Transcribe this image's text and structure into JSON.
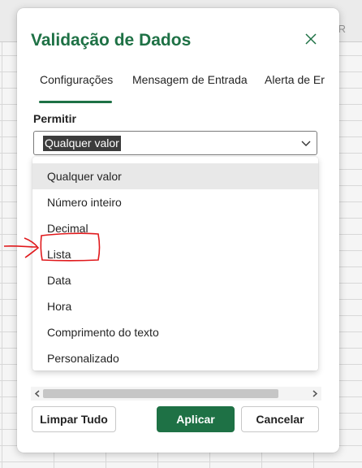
{
  "spreadsheet": {
    "column_letter": "R"
  },
  "dialog": {
    "title": "Validação de Dados",
    "close_icon": "close-icon",
    "tabs": [
      {
        "label": "Configurações",
        "active": true
      },
      {
        "label": "Mensagem de Entrada",
        "active": false
      },
      {
        "label": "Alerta de Er",
        "active": false
      }
    ],
    "permit": {
      "label": "Permitir",
      "selected_value": "Qualquer valor",
      "chevron_icon": "chevron-down-icon"
    },
    "dropdown": {
      "options": [
        {
          "label": "Qualquer valor",
          "selected": true
        },
        {
          "label": "Número inteiro",
          "selected": false
        },
        {
          "label": "Decimal",
          "selected": false
        },
        {
          "label": "Lista",
          "selected": false
        },
        {
          "label": "Data",
          "selected": false
        },
        {
          "label": "Hora",
          "selected": false
        },
        {
          "label": "Comprimento do texto",
          "selected": false
        },
        {
          "label": "Personalizado",
          "selected": false
        }
      ]
    },
    "buttons": {
      "clear_all": "Limpar Tudo",
      "apply": "Aplicar",
      "cancel": "Cancelar"
    }
  },
  "colors": {
    "accent": "#1e7145",
    "annotation": "#e0191c"
  }
}
